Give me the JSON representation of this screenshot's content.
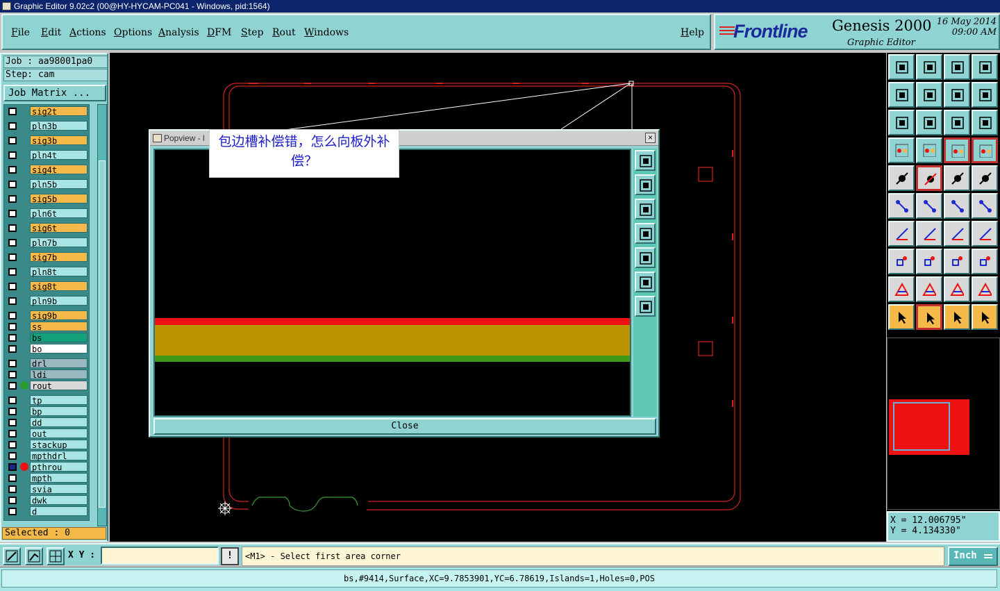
{
  "window": {
    "title": "Graphic Editor 9.02c2 (00@HY-HYCAM-PC041 - Windows, pid:1564)"
  },
  "menu": {
    "items": [
      "File",
      "Edit",
      "Actions",
      "Options",
      "Analysis",
      "DFM",
      "Step",
      "Rout",
      "Windows"
    ],
    "help": "Help"
  },
  "brand": {
    "logo": "Frontline",
    "product": "Genesis 2000",
    "subtitle": "Graphic Editor",
    "date": "16 May 2014",
    "time": "09:00 AM"
  },
  "job": {
    "job_label": "Job : aa98001pa0",
    "step_label": "Step: cam",
    "matrix_button": "Job Matrix ..."
  },
  "layers": [
    {
      "name": "sig2t",
      "color": "#f5b94a"
    },
    {
      "name": "pln3b",
      "color": "#a8e6e6"
    },
    {
      "name": "sig3b",
      "color": "#f5b94a"
    },
    {
      "name": "pln4t",
      "color": "#a8e6e6"
    },
    {
      "name": "sig4t",
      "color": "#f5b94a"
    },
    {
      "name": "pln5b",
      "color": "#a8e6e6"
    },
    {
      "name": "sig5b",
      "color": "#f5b94a"
    },
    {
      "name": "pln6t",
      "color": "#a8e6e6"
    },
    {
      "name": "sig6t",
      "color": "#f5b94a"
    },
    {
      "name": "pln7b",
      "color": "#a8e6e6"
    },
    {
      "name": "sig7b",
      "color": "#f5b94a"
    },
    {
      "name": "pln8t",
      "color": "#a8e6e6"
    },
    {
      "name": "sig8t",
      "color": "#f5b94a"
    },
    {
      "name": "pln9b",
      "color": "#a8e6e6"
    },
    {
      "name": "sig9b",
      "color": "#f5b94a"
    },
    {
      "name": "ss",
      "color": "#f5b94a"
    },
    {
      "name": "bs",
      "color": "#14a07a"
    },
    {
      "name": "bo",
      "color": "#ffffff"
    },
    {
      "name": "drl",
      "color": "#9ab8c0"
    },
    {
      "name": "ldi",
      "color": "#9ab8c0"
    },
    {
      "name": "rout",
      "color": "#d8d8d8"
    },
    {
      "name": "tp",
      "color": "#a8e6e6"
    },
    {
      "name": "bp",
      "color": "#a8e6e6"
    },
    {
      "name": "dd",
      "color": "#a8e6e6"
    },
    {
      "name": "out",
      "color": "#a8e6e6"
    },
    {
      "name": "stackup",
      "color": "#a8e6e6"
    },
    {
      "name": "mpthdrl",
      "color": "#a8e6e6"
    },
    {
      "name": "pthrou",
      "color": "#a8e6e6"
    },
    {
      "name": "mpth",
      "color": "#a8e6e6"
    },
    {
      "name": "svia",
      "color": "#a8e6e6"
    },
    {
      "name": "dwk",
      "color": "#a8e6e6"
    },
    {
      "name": "d",
      "color": "#a8e6e6"
    }
  ],
  "selected": "Selected : 0",
  "coords": {
    "x": "X = 12.006795\"",
    "y": "Y = 4.134330\""
  },
  "statusbar": {
    "xy_label": "X Y :",
    "xy_value": "",
    "excl": "!",
    "prompt": "<M1> - Select first area corner",
    "unit": "Inch"
  },
  "info": "bs,#9414,Surface,XC=9.7853901,YC=6.78619,Islands=1,Holes=0,POS",
  "popview": {
    "title": "Popview - l",
    "close": "Close",
    "close_x": "×"
  },
  "callout": {
    "text": "包边槽补偿错，怎么向板外补偿？"
  },
  "colors": {
    "accent_cyan": "#8fd3d3",
    "layer_orange": "#f5b94a",
    "board_outline": "#d22222",
    "title_blue": "#0b246b"
  }
}
